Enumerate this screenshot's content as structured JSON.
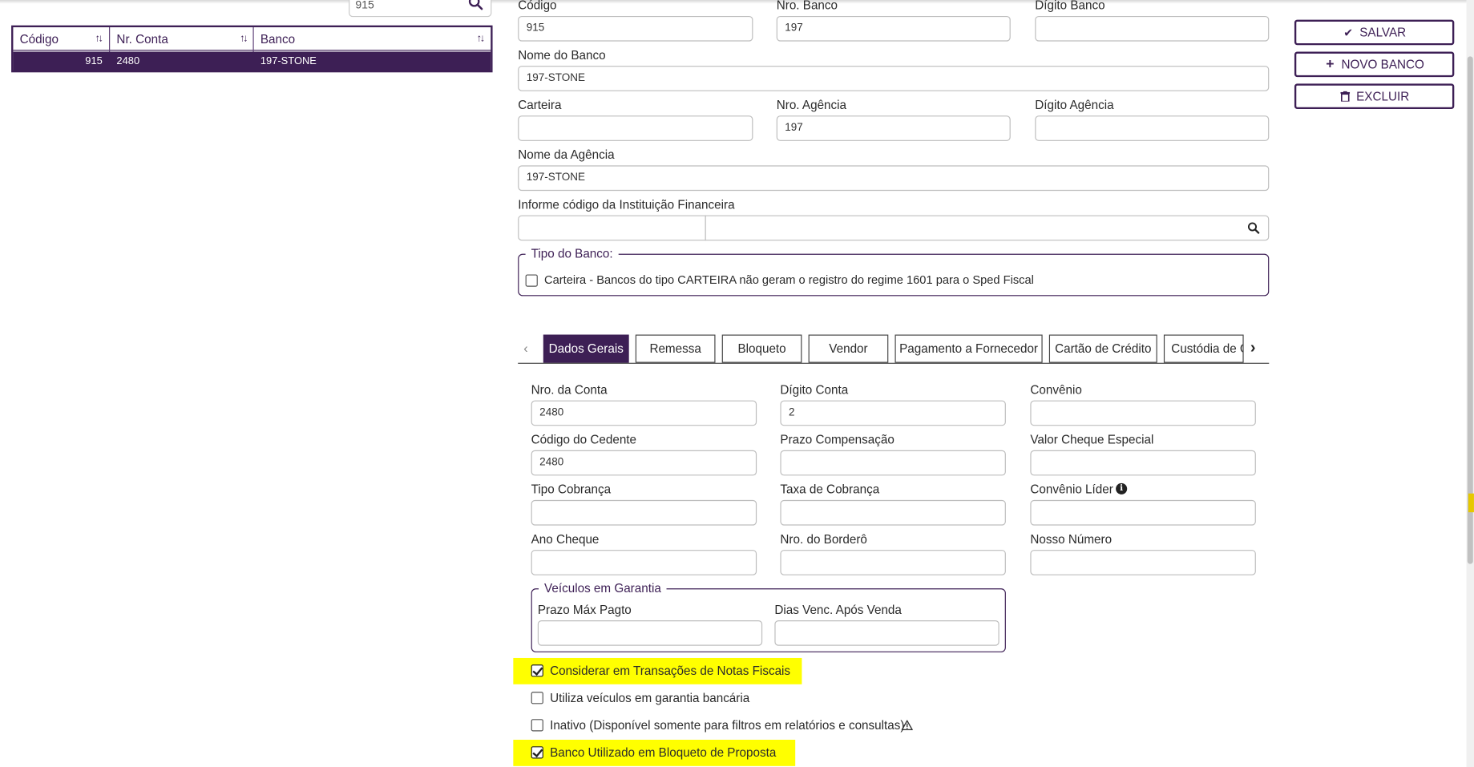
{
  "search": {
    "value": "915"
  },
  "grid": {
    "columns": [
      "Código",
      "Nr. Conta",
      "Banco"
    ],
    "rows": [
      {
        "codigo": "915",
        "nr_conta": "2480",
        "banco": "197-STONE"
      }
    ]
  },
  "form": {
    "codigo": {
      "label": "Código",
      "value": "915"
    },
    "nro_banco": {
      "label": "Nro. Banco",
      "value": "197"
    },
    "digito_banco": {
      "label": "Dígito Banco",
      "value": ""
    },
    "nome_banco": {
      "label": "Nome do Banco",
      "value": "197-STONE"
    },
    "carteira": {
      "label": "Carteira",
      "value": ""
    },
    "nro_agencia": {
      "label": "Nro. Agência",
      "value": "197"
    },
    "digito_agencia": {
      "label": "Dígito Agência",
      "value": ""
    },
    "nome_agencia": {
      "label": "Nome da Agência",
      "value": "197-STONE"
    },
    "instituicao": {
      "label": "Informe código da Instituição Financeira",
      "code": "",
      "name": ""
    },
    "tipo_banco": {
      "legend": "Tipo do Banco:",
      "carteira_label": "Carteira - Bancos do tipo CARTEIRA não geram o registro do regime 1601 para o Sped Fiscal",
      "carteira_checked": false
    }
  },
  "buttons": {
    "save": "SALVAR",
    "new": "NOVO BANCO",
    "delete": "EXCLUIR"
  },
  "tabs": [
    "Dados Gerais",
    "Remessa",
    "Bloqueto",
    "Vendor",
    "Pagamento a Fornecedor",
    "Cartão de Crédito",
    "Custódia de C"
  ],
  "active_tab": "Dados Gerais",
  "dados_gerais": {
    "nro_conta": {
      "label": "Nro. da Conta",
      "value": "2480"
    },
    "digito_conta": {
      "label": "Dígito Conta",
      "value": "2"
    },
    "convenio": {
      "label": "Convênio",
      "value": ""
    },
    "codigo_cedente": {
      "label": "Código do Cedente",
      "value": "2480"
    },
    "prazo_compensacao": {
      "label": "Prazo Compensação",
      "value": ""
    },
    "valor_cheque_especial": {
      "label": "Valor Cheque Especial",
      "value": ""
    },
    "tipo_cobranca": {
      "label": "Tipo Cobrança",
      "value": ""
    },
    "taxa_cobranca": {
      "label": "Taxa de Cobrança",
      "value": ""
    },
    "convenio_lider": {
      "label": "Convênio Líder",
      "value": ""
    },
    "ano_cheque": {
      "label": "Ano Cheque",
      "value": ""
    },
    "nro_bordero": {
      "label": "Nro. do Borderô",
      "value": ""
    },
    "nosso_numero": {
      "label": "Nosso Número",
      "value": ""
    },
    "veiculos": {
      "legend": "Veículos em Garantia",
      "prazo_max": {
        "label": "Prazo Máx Pagto",
        "value": ""
      },
      "dias_venc": {
        "label": "Dias Venc. Após Venda",
        "value": ""
      }
    },
    "checks": [
      {
        "label": "Considerar em Transações de Notas Fiscais",
        "checked": true,
        "highlight": true
      },
      {
        "label": "Utiliza veículos em garantia bancária",
        "checked": false,
        "highlight": false
      },
      {
        "label": "Inativo (Disponível somente para filtros em relatórios e consultas)",
        "checked": false,
        "highlight": false
      },
      {
        "label": "Banco Utilizado em Bloqueto de Proposta",
        "checked": true,
        "highlight": true
      }
    ]
  },
  "colors": {
    "primary": "#3d1f55",
    "highlight": "#ffff00"
  }
}
